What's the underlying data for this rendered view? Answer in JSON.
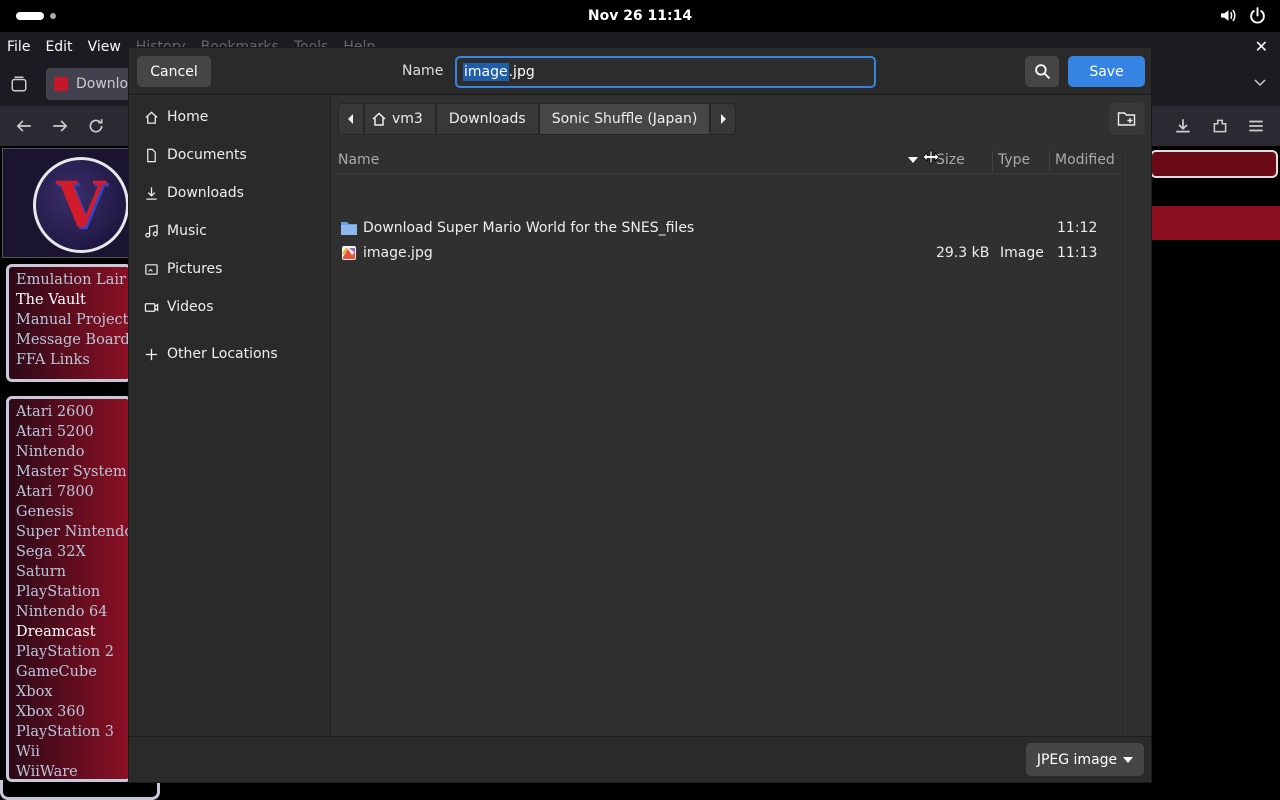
{
  "topbar": {
    "clock": "Nov 26  11:14"
  },
  "firefox": {
    "menu": [
      "File",
      "Edit",
      "View",
      "History",
      "Bookmarks",
      "Tools",
      "Help"
    ],
    "tab_title": "Downlo"
  },
  "website": {
    "nav_links": [
      "Emulation Lair",
      "The Vault",
      "Manual Project",
      "Message Boards",
      "FFA Links"
    ],
    "systems": [
      "Atari 2600",
      "Atari 5200",
      "Nintendo",
      "Master System",
      "Atari 7800",
      "Genesis",
      "Super Nintendo",
      "Sega 32X",
      "Saturn",
      "PlayStation",
      "Nintendo 64",
      "Dreamcast",
      "PlayStation 2",
      "GameCube",
      "Xbox",
      "Xbox 360",
      "PlayStation 3",
      "Wii",
      "WiiWare"
    ]
  },
  "dialog": {
    "cancel_label": "Cancel",
    "name_label": "Name",
    "filename_selected": "image",
    "filename_rest": ".jpg",
    "save_label": "Save",
    "sidebar": [
      {
        "label": "Home",
        "icon": "home-icon"
      },
      {
        "label": "Documents",
        "icon": "document-icon"
      },
      {
        "label": "Downloads",
        "icon": "download-icon"
      },
      {
        "label": "Music",
        "icon": "music-icon"
      },
      {
        "label": "Pictures",
        "icon": "picture-icon"
      },
      {
        "label": "Videos",
        "icon": "video-icon"
      },
      {
        "label": "Other Locations",
        "icon": "plus-icon"
      }
    ],
    "path": [
      "vm3",
      "Downloads",
      "Sonic Shuffle (Japan)"
    ],
    "columns": {
      "name": "Name",
      "size": "Size",
      "type": "Type",
      "modified": "Modified"
    },
    "files": [
      {
        "name": "Download Super Mario World for the SNES_files",
        "size": "",
        "type": "",
        "modified": "11:12",
        "kind": "folder"
      },
      {
        "name": "image.jpg",
        "size": "29.3 kB",
        "type": "Image",
        "modified": "11:13",
        "kind": "image"
      }
    ],
    "filter": "JPEG image"
  }
}
